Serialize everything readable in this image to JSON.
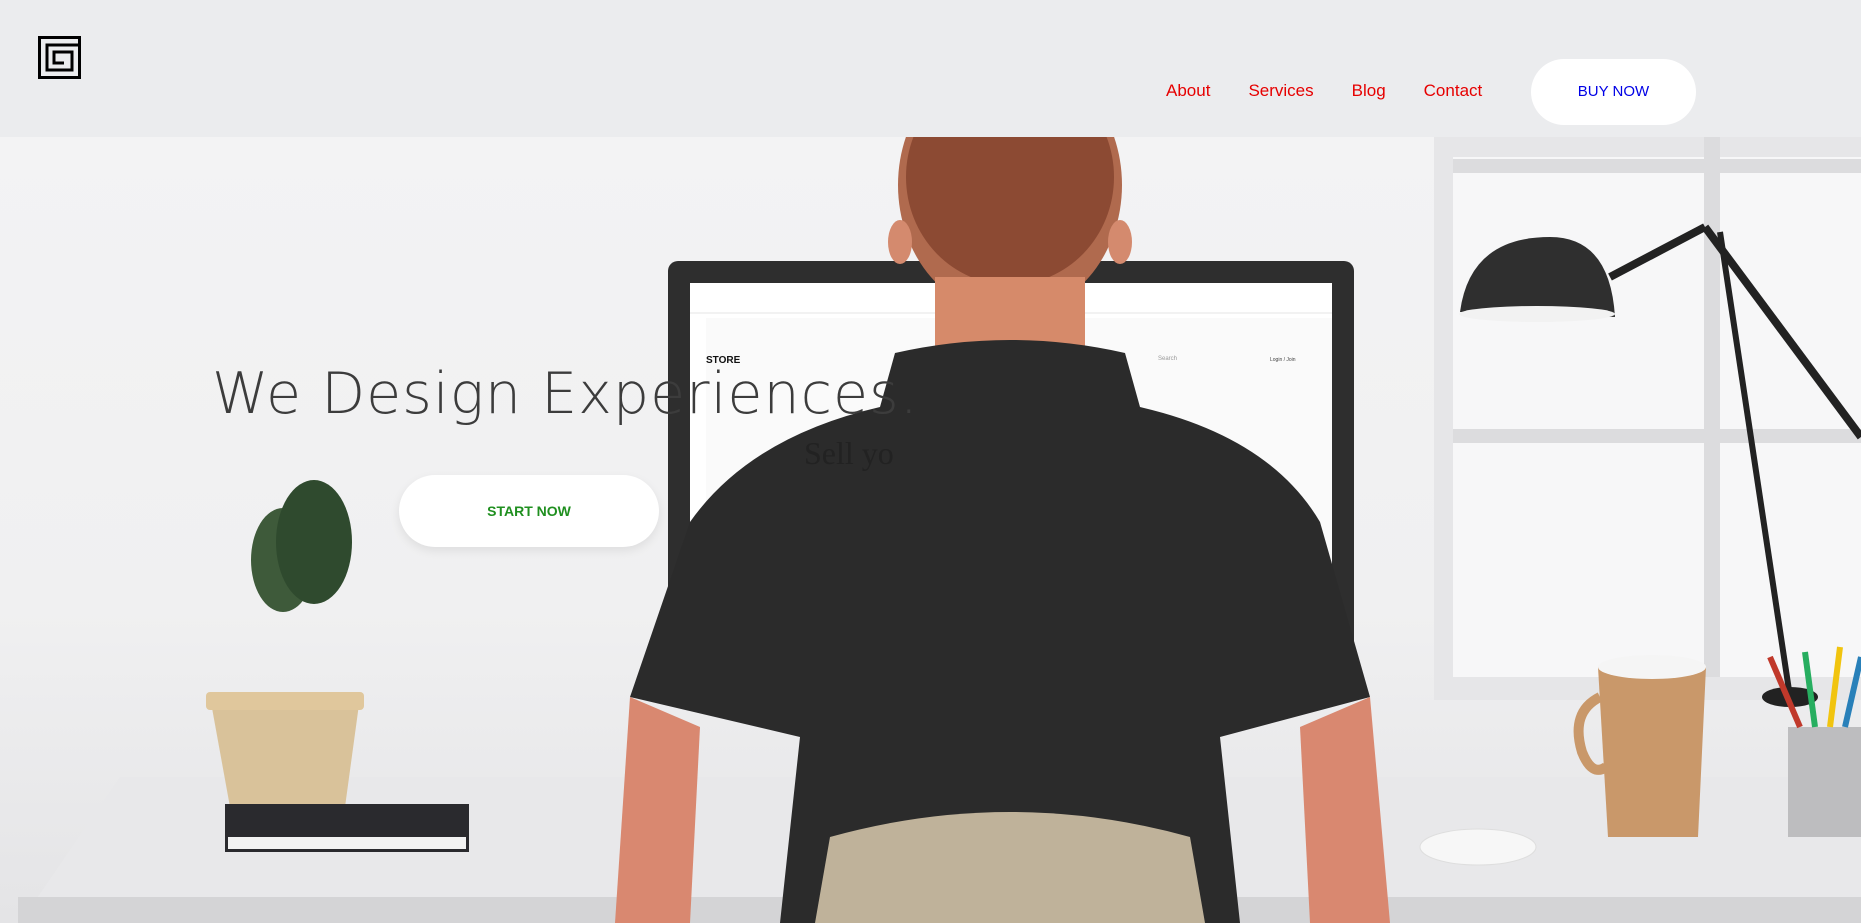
{
  "header": {
    "logo_icon": "square-spiral-logo-icon",
    "nav": [
      {
        "label": "About"
      },
      {
        "label": "Services"
      },
      {
        "label": "Blog"
      },
      {
        "label": "Contact"
      }
    ],
    "buy_button": "BUY NOW",
    "nav_color": "#e60000",
    "buy_color": "#0000e6"
  },
  "hero": {
    "title": "We Design Experiences.",
    "start_button": "START NOW",
    "start_color": "#1f8f1f",
    "monitor": {
      "brand": "STORE",
      "search": "Search",
      "login": "Login / Join",
      "headline": "Sell yo"
    }
  }
}
